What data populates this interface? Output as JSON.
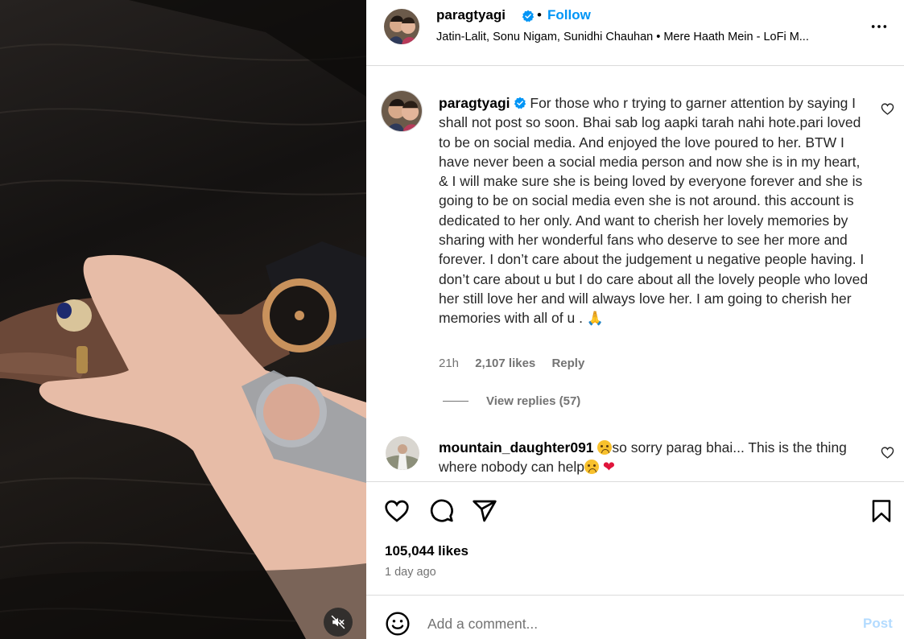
{
  "post": {
    "username": "paragtyagi",
    "follow_label": "Follow",
    "separator": "•",
    "audio": "Jatin-Lalit, Sonu Nigam, Sunidhi Chauhan • Mere Haath Mein - LoFi M..."
  },
  "caption": {
    "username": "paragtyagi",
    "text": "For those who r trying to garner attention by saying I shall not post so soon. Bhai sab log aapki tarah nahi hote.pari loved to be on social media. And enjoyed the love poured to her. BTW I have never been a social media person and now she is in my heart, & I will make sure she is being loved by everyone forever and she is going to be on social media even she is not around. this account is dedicated to her only. And want to cherish her lovely memories by sharing with her wonderful fans who deserve to see her more and forever. I don’t care about the judgement u negative people having. I don’t care about u but I do care about all the lovely people who loved her still love her and will always love her. I am going to cherish her memories with all of u .",
    "emoji": "🙏",
    "time": "21h",
    "likes": "2,107 likes",
    "reply_label": "Reply",
    "view_replies": "View replies (57)"
  },
  "comment": {
    "username": "mountain_daughter091",
    "text_part1": "so sorry parag bhai... This is the thing where nobody can help",
    "heart": "❤"
  },
  "actions": {
    "like_count": "105,044 likes",
    "time_ago": "1 day ago"
  },
  "composer": {
    "placeholder": "Add a comment...",
    "post_label": "Post"
  },
  "colors": {
    "accent": "#0095f6",
    "muted": "#737373",
    "border": "#dbdbdb",
    "post_disabled": "#b3dbff"
  }
}
